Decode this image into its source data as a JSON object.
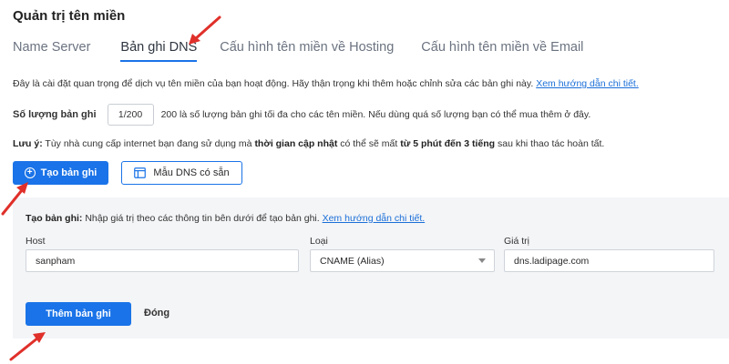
{
  "page": {
    "title": "Quản trị tên miền"
  },
  "tabs": [
    {
      "label": "Name Server"
    },
    {
      "label": "Bản ghi DNS"
    },
    {
      "label": "Cấu hình tên miền về Hosting"
    },
    {
      "label": "Cấu hình tên miền về Email"
    }
  ],
  "info": {
    "text": "Đây là cài đặt quan trọng để dịch vụ tên miền của bạn hoạt động. Hãy thận trọng khi thêm hoặc chỉnh sửa các bản ghi này.",
    "link": "Xem hướng dẫn chi tiết."
  },
  "quota": {
    "label": "Số lượng bản ghi",
    "value": "1/200",
    "description": "200 là số lượng bản ghi tối đa cho các tên miền. Nếu dùng quá số lượng bạn có thể mua thêm ở đây."
  },
  "note": {
    "label": "Lưu ý:",
    "part1": " Tùy nhà cung cấp internet bạn đang sử dụng mà ",
    "bold1": "thời gian cập nhật",
    "part2": " có thể sẽ mất ",
    "bold2": "từ 5 phút đến 3 tiếng",
    "part3": " sau khi thao tác hoàn tất."
  },
  "toolbar": {
    "create_label": "Tạo bản ghi",
    "template_label": "Mẫu DNS có sẵn"
  },
  "form": {
    "desc_label": "Tạo bản ghi:",
    "desc_text": " Nhập giá trị theo các thông tin bên dưới để tạo bản ghi. ",
    "desc_link": "Xem hướng dẫn chi tiết.",
    "host_label": "Host",
    "host_value": "sanpham",
    "type_label": "Loại",
    "type_value": "CNAME (Alias)",
    "value_label": "Giá trị",
    "value_value": "dns.ladipage.com",
    "add_label": "Thêm bản ghi",
    "close_label": "Đóng"
  },
  "colors": {
    "accent": "#1a73e8",
    "annotation_arrow": "#e0302a",
    "panel_bg": "#f4f5f7"
  }
}
